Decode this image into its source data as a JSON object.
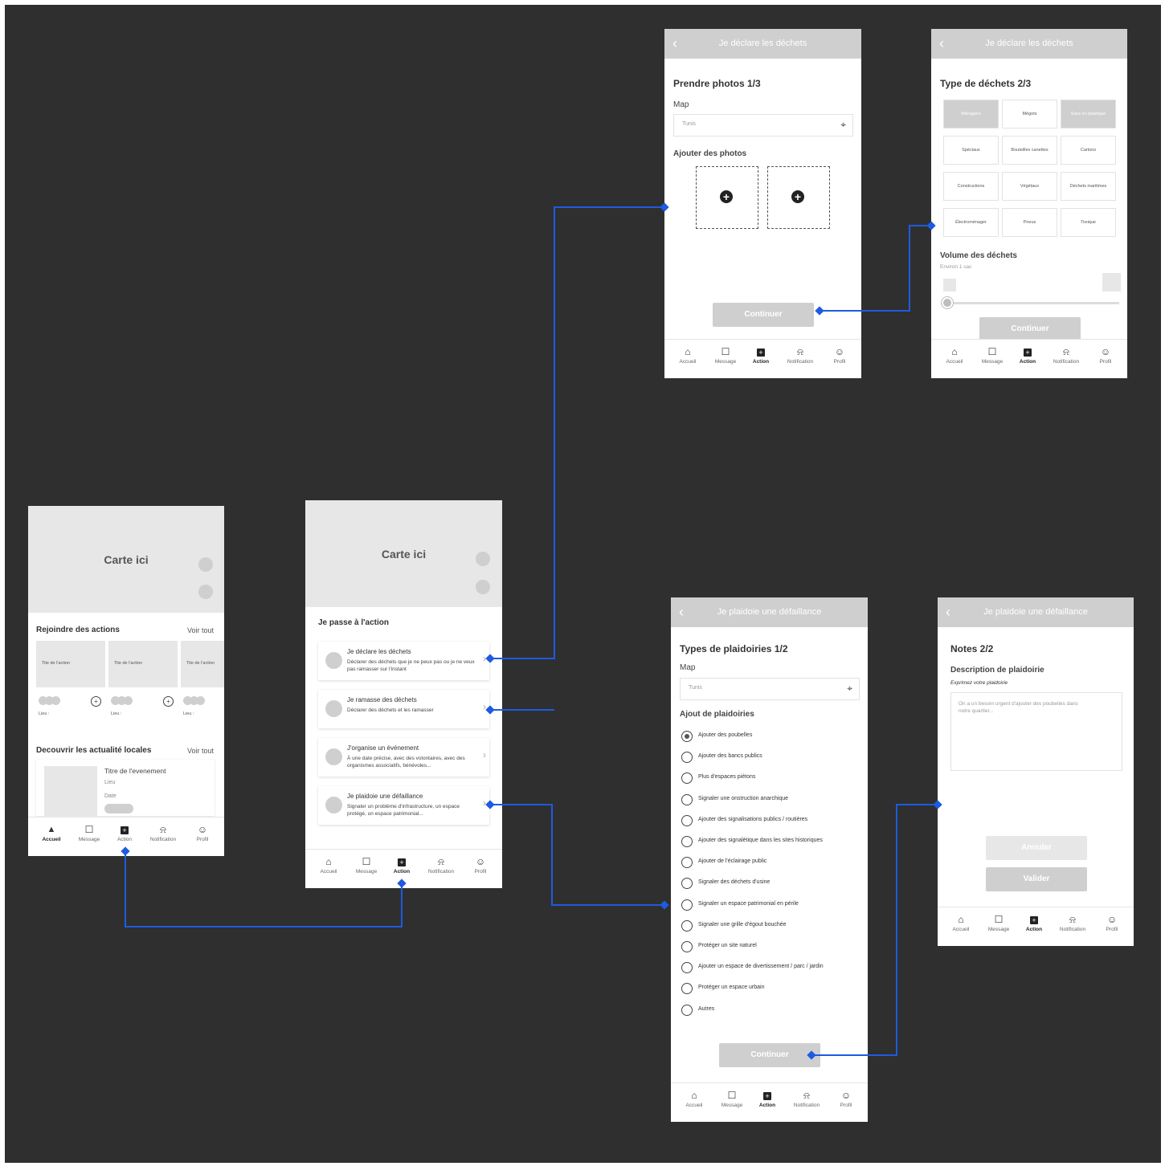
{
  "colors": {
    "background": "#2f2f2f",
    "connector": "#1d5be0",
    "placeholder": "#cfcfcf",
    "screen": "#ffffff"
  },
  "tabs": [
    {
      "label": "Accueil",
      "icon": "home-icon"
    },
    {
      "label": "Message",
      "icon": "message-icon"
    },
    {
      "label": "Action",
      "icon": "add-box-icon"
    },
    {
      "label": "Notification",
      "icon": "bell-icon"
    },
    {
      "label": "Profil",
      "icon": "smiley-icon"
    }
  ],
  "home": {
    "map_label": "Carte ici",
    "join_title": "Rejoindre des actions",
    "see_all": "Voir tout",
    "cards": [
      {
        "title": "Tite de l'action",
        "lieu": "Lieu :"
      },
      {
        "title": "Tite de l'action",
        "lieu": "Lieu :"
      },
      {
        "title": "Tite de l'action",
        "lieu": "Lieu :"
      }
    ],
    "news_title": "Decouvrir les actualité locales",
    "news_see_all": "Voir tout",
    "event": {
      "title": "Titre de l'evenement",
      "place": "Lieu",
      "date": "Date"
    }
  },
  "action": {
    "map_label": "Carte ici",
    "title": "Je passe à l'action",
    "items": [
      {
        "title": "Je déclare les déchets",
        "desc": "Déclarer des déchets que je ne peux pas ou je ne veux pas ramasser sur l'instant"
      },
      {
        "title": "Je ramasse des déchets",
        "desc": "Déclarer des déchets et les ramasser"
      },
      {
        "title": "J'organise un événement",
        "desc": "À une date précise, avec des volontaires, avec des organismes associatifs, bénévoles..."
      },
      {
        "title": "Je plaidoie une défaillance",
        "desc": "Signaler un problème d'infrastructure, un espace protégé, un espace patrimonial..."
      }
    ]
  },
  "photos": {
    "header": "Je déclare les déchets",
    "step_title": "Prendre photos 1/3",
    "map_label": "Map",
    "map_value": "Tunis",
    "add_photos": "Ajouter des photos",
    "continue": "Continuer"
  },
  "types": {
    "header": "Je déclare les déchets",
    "step_title": "Type de déchets 2/3",
    "categories": [
      "Ménagers",
      "Mégots",
      "Sacs en plastique",
      "Spéciaux",
      "Bouteilles canettes",
      "Cartons",
      "Constructions",
      "Végétaux",
      "Déchets maritimes",
      "Électroménager",
      "Pneus",
      "Toxique"
    ],
    "selected": [
      0,
      2
    ],
    "volume_title": "Volume des déchets",
    "volume_value": "Environ 1 sac",
    "volume_level": 0.0,
    "continue": "Continuer"
  },
  "plaid1": {
    "header": "Je plaidoie une défaillance",
    "step_title": "Types de plaidoiries 1/2",
    "map_label": "Map",
    "map_value": "Tunis",
    "options_title": "Ajout de plaidoiries",
    "options": [
      "Ajouter des poubelles",
      "Ajouter des bancs publics",
      "Plus d'espaces piétons",
      "Signaler une onstruction anarchique",
      "Ajouter des signalisations publics / routières",
      "Ajouter des signalétique dans les sites historiques",
      "Ajouter de l'éclairage public",
      "Signaler des déchets d'usine",
      "Signaler un espace patrimonial en périle",
      "Signaler une grille d'égout bouchée",
      "Protéger un site naturel",
      "Ajouter un espace de divertissement / parc / jardin",
      "Protéger un espace urbain",
      "Autres"
    ],
    "selected": 0,
    "continue": "Continuer"
  },
  "plaid2": {
    "header": "Je plaidoie une défaillance",
    "step_title": "Notes 2/2",
    "desc_title": "Description de plaidoirie",
    "desc_sub": "Exprimez votre plaidoirie",
    "placeholder": "On a un besoin urgent d'ajouter des poubelles dans notre quartier...",
    "cancel": "Annuler",
    "validate": "Valider"
  }
}
